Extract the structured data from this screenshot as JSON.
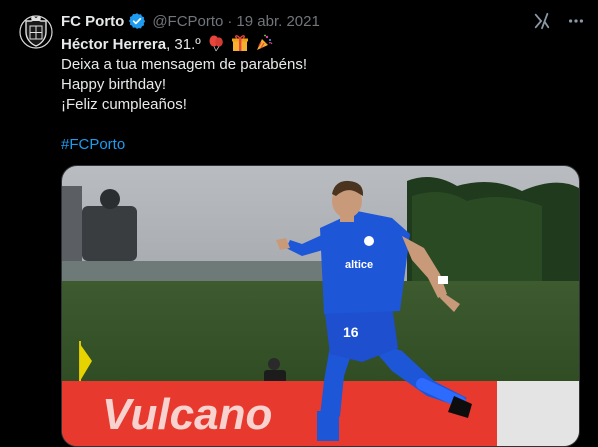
{
  "tweet": {
    "author_name": "FC Porto",
    "handle": "@FCPorto",
    "separator": "·",
    "date": "19 abr. 2021",
    "lines": {
      "player_name": "Héctor Herrera",
      "age": ", 31.º",
      "line2": "Deixa a tua mensagem de parabéns!",
      "line3": "Happy birthday!",
      "line4": "¡Feliz cumpleaños!"
    },
    "hashtag": "#FCPorto",
    "shirt_sponsor": "altice",
    "shirt_number": "16",
    "banner_text": "Vulcano"
  },
  "icons": {
    "verified": "verified-badge-icon",
    "grok": "grok-icon",
    "more": "more-icon",
    "avatar": "fc-porto-crest-icon"
  },
  "colors": {
    "accent": "#1d9bf0",
    "background": "#000000",
    "text": "#e7e9ea",
    "muted": "#71767b",
    "kit_blue": "#1e56d8",
    "banner_red": "#e8392e"
  }
}
